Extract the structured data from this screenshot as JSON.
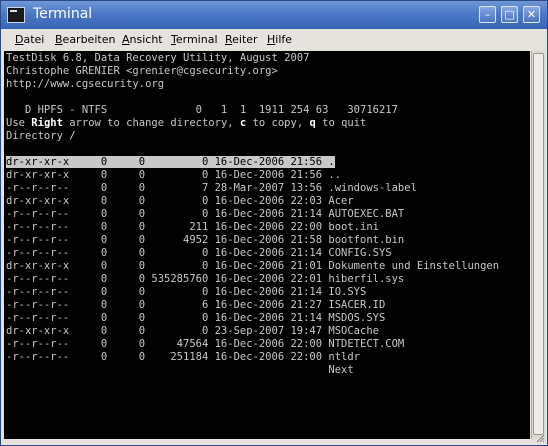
{
  "window": {
    "title": "Terminal"
  },
  "menu": [
    "Datei",
    "Bearbeiten",
    "Ansicht",
    "Terminal",
    "Reiter",
    "Hilfe"
  ],
  "header_lines": [
    "TestDisk 6.8, Data Recovery Utility, August 2007",
    "Christophe GRENIER <grenier@cgsecurity.org>",
    "http://www.cgsecurity.org",
    "",
    "   D HPFS - NTFS              0   1  1  1911 254 63   30716217"
  ],
  "help_line": {
    "p1": "Use ",
    "k1": "Right",
    "p2": " arrow to change directory, ",
    "k2": "c",
    "p3": " to copy, ",
    "k3": "q",
    "p4": " to quit"
  },
  "directory_line": "Directory /",
  "file_rows": [
    "dr-xr-xr-x     0     0         0 16-Dec-2006 21:56 .",
    "dr-xr-xr-x     0     0         0 16-Dec-2006 21:56 ..",
    "-r--r--r--     0     0         7 28-Mar-2007 13:56 .windows-label",
    "dr-xr-xr-x     0     0         0 16-Dec-2006 22:03 Acer",
    "-r--r--r--     0     0         0 16-Dec-2006 21:14 AUTOEXEC.BAT",
    "-r--r--r--     0     0       211 16-Dec-2006 22:00 boot.ini",
    "-r--r--r--     0     0      4952 16-Dec-2006 21:58 bootfont.bin",
    "-r--r--r--     0     0         0 16-Dec-2006 21:14 CONFIG.SYS",
    "dr-xr-xr-x     0     0         0 16-Dec-2006 21:01 Dokumente und Einstellungen",
    "-r--r--r--     0     0 535285760 16-Dec-2006 22:01 hiberfil.sys",
    "-r--r--r--     0     0         0 16-Dec-2006 21:14 IO.SYS",
    "-r--r--r--     0     0         6 16-Dec-2006 21:27 ISACER.ID",
    "-r--r--r--     0     0         0 16-Dec-2006 21:14 MSDOS.SYS",
    "dr-xr-xr-x     0     0         0 23-Sep-2007 19:47 MSOCache",
    "-r--r--r--     0     0     47564 16-Dec-2006 22:00 NTDETECT.COM",
    "-r--r--r--     0     0    251184 16-Dec-2006 22:00 ntldr",
    "                                                   Next"
  ],
  "selected_row": 0,
  "icons": {
    "app": "terminal-app-icon",
    "minimize": "minimize-icon",
    "maximize": "maximize-icon",
    "close": "close-icon"
  }
}
